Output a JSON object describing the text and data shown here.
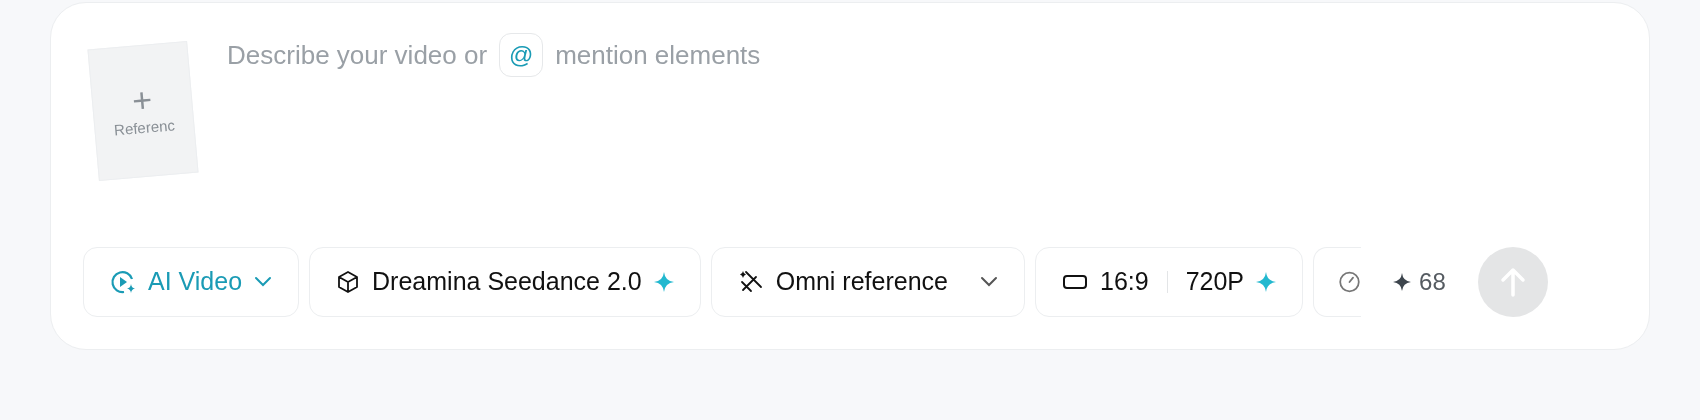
{
  "prompt": {
    "placeholder_before": "Describe your video or",
    "mention_key": "@",
    "placeholder_after": "mention elements"
  },
  "reference_tile": {
    "plus": "+",
    "label": "Referenc"
  },
  "toolbar": [
    {
      "kind": "mode",
      "label": "AI Video"
    },
    {
      "kind": "model",
      "label": "Dreamina Seedance 2.0"
    },
    {
      "kind": "reference",
      "label": "Omni reference"
    },
    {
      "kind": "format",
      "ratio": "16:9",
      "resolution": "720P"
    },
    {
      "kind": "duration"
    }
  ],
  "credits": "68",
  "send_button": {
    "disabled": true
  }
}
